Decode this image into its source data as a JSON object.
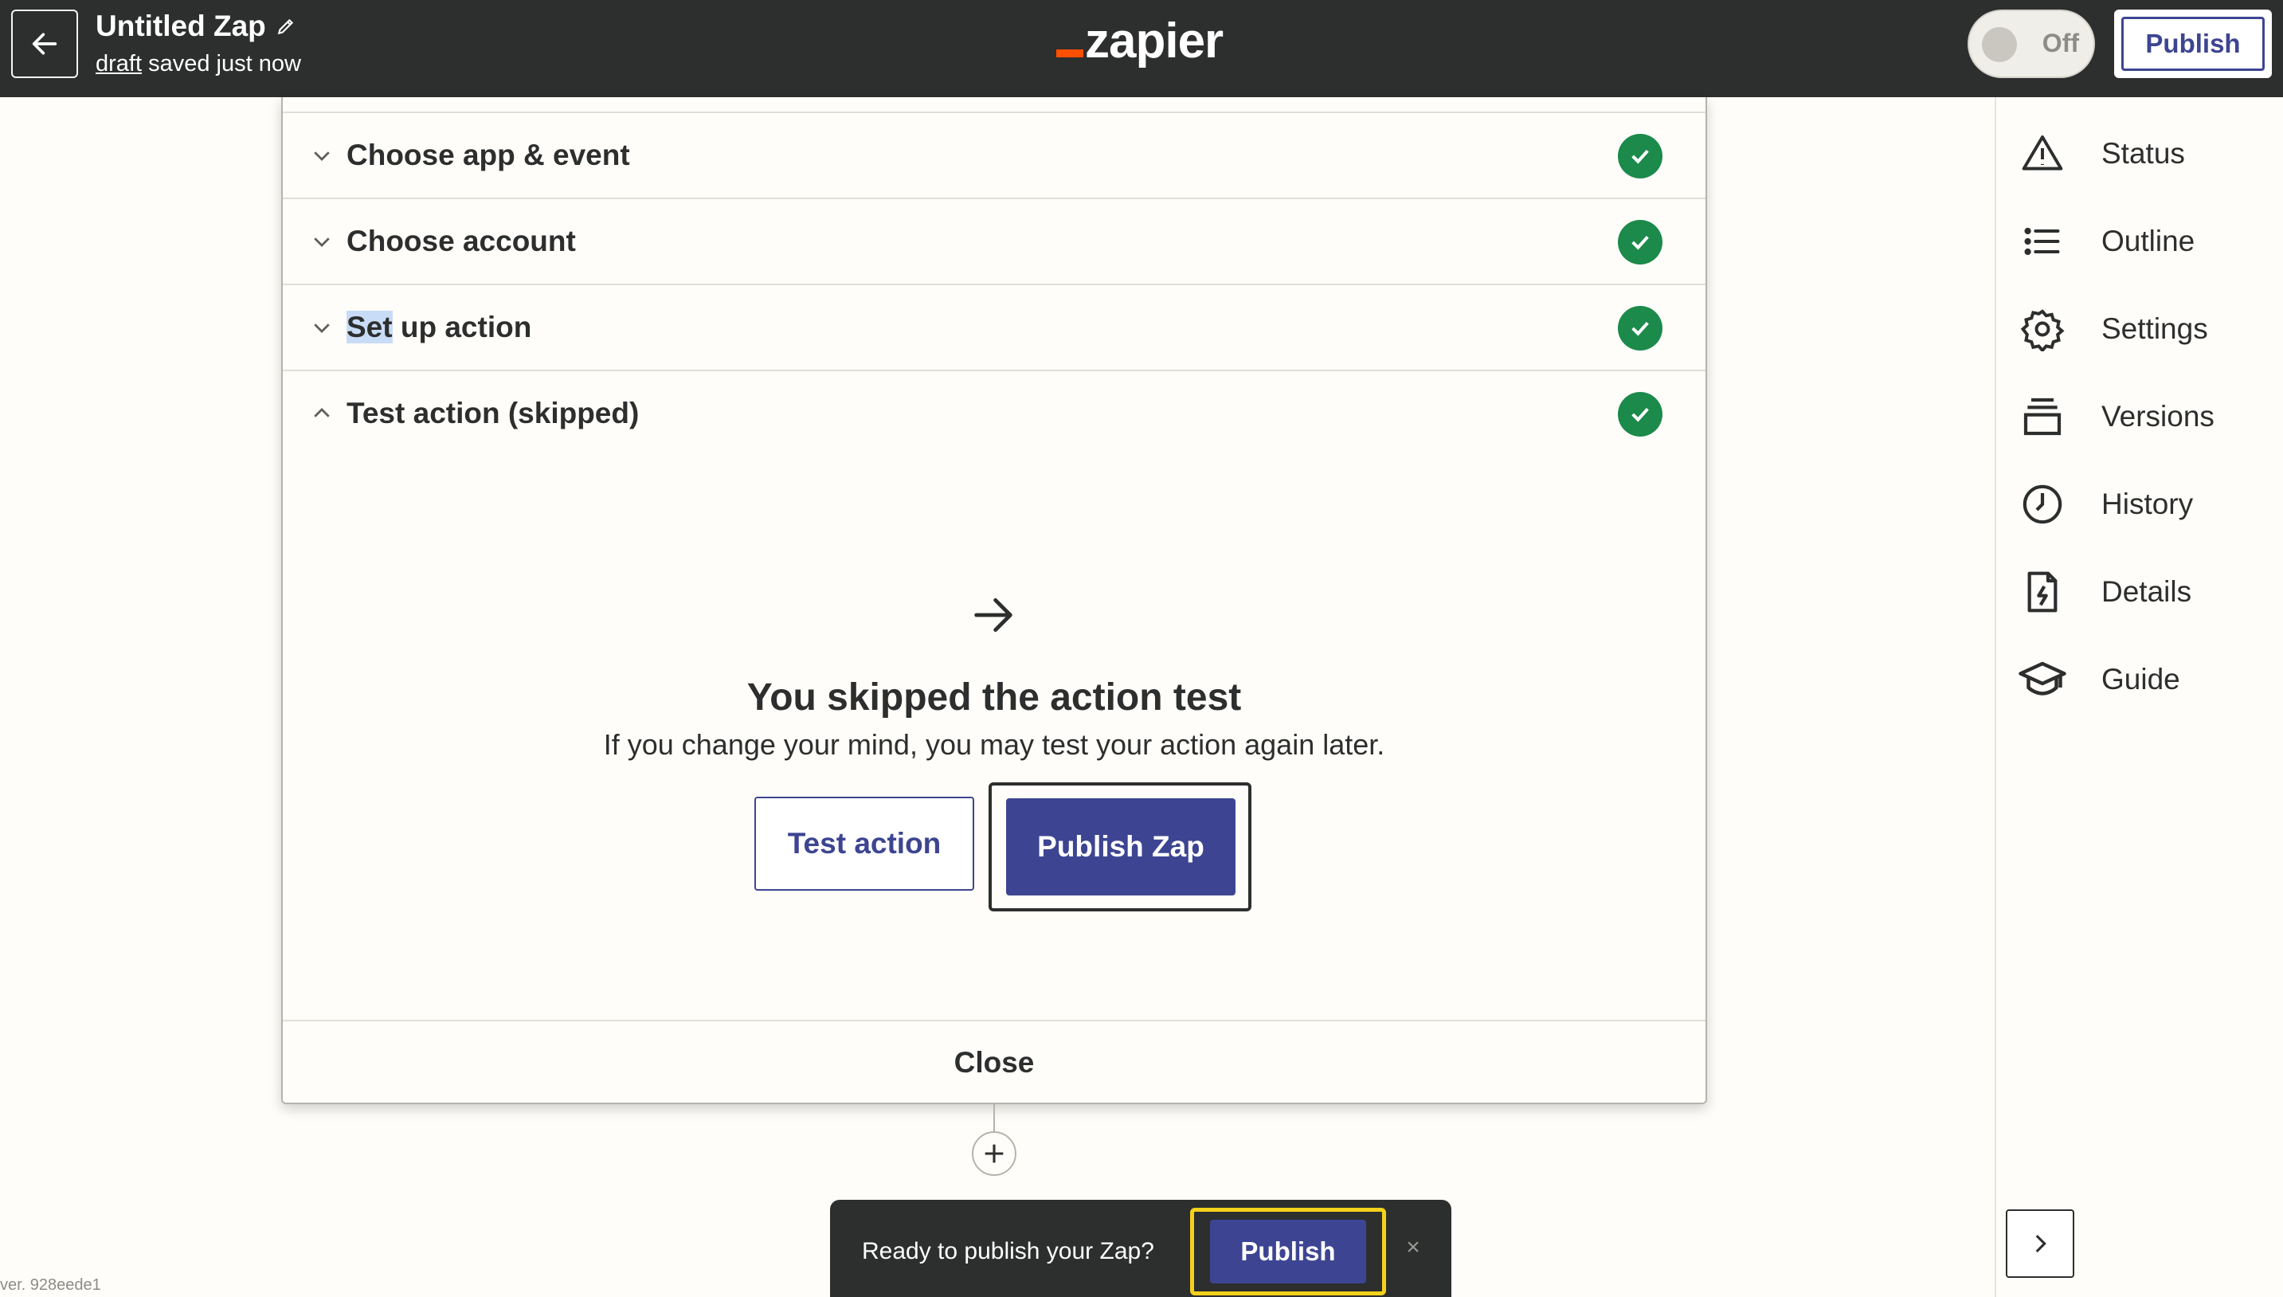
{
  "header": {
    "title": "Untitled Zap",
    "draft_link": "draft",
    "saved_text": "saved just now",
    "logo_text": "zapier",
    "toggle_label": "Off",
    "publish_label": "Publish"
  },
  "sidebar": {
    "items": [
      {
        "label": "Status",
        "icon": "warning-triangle-icon"
      },
      {
        "label": "Outline",
        "icon": "list-icon"
      },
      {
        "label": "Settings",
        "icon": "gear-icon"
      },
      {
        "label": "Versions",
        "icon": "layers-icon"
      },
      {
        "label": "History",
        "icon": "clock-icon"
      },
      {
        "label": "Details",
        "icon": "file-bolt-icon"
      },
      {
        "label": "Guide",
        "icon": "graduation-cap-icon"
      }
    ]
  },
  "panel": {
    "sections": [
      {
        "title": "Choose app & event",
        "expanded": false,
        "complete": true
      },
      {
        "title_highlight": "Set",
        "title": "Choose account",
        "expanded": false,
        "complete": true
      },
      {
        "title_highlight": "Set",
        "title_rest": " up action",
        "expanded": false,
        "complete": true
      },
      {
        "title": "Test action (skipped)",
        "expanded": true,
        "complete": true
      }
    ],
    "skipped_title": "You skipped the action test",
    "skipped_subtitle": "If you change your mind, you may test your action again later.",
    "test_action_label": "Test action",
    "publish_zap_label": "Publish Zap",
    "close_label": "Close"
  },
  "toast": {
    "text": "Ready to publish your Zap?",
    "publish_label": "Publish",
    "close_symbol": "×"
  },
  "version_text": "ver. 928eede1",
  "colors": {
    "topbar": "#2d2e2e",
    "brand_orange": "#ff4f00",
    "primary": "#3d4592",
    "success": "#1b8a4b",
    "focus_yellow": "#f4d21b"
  }
}
